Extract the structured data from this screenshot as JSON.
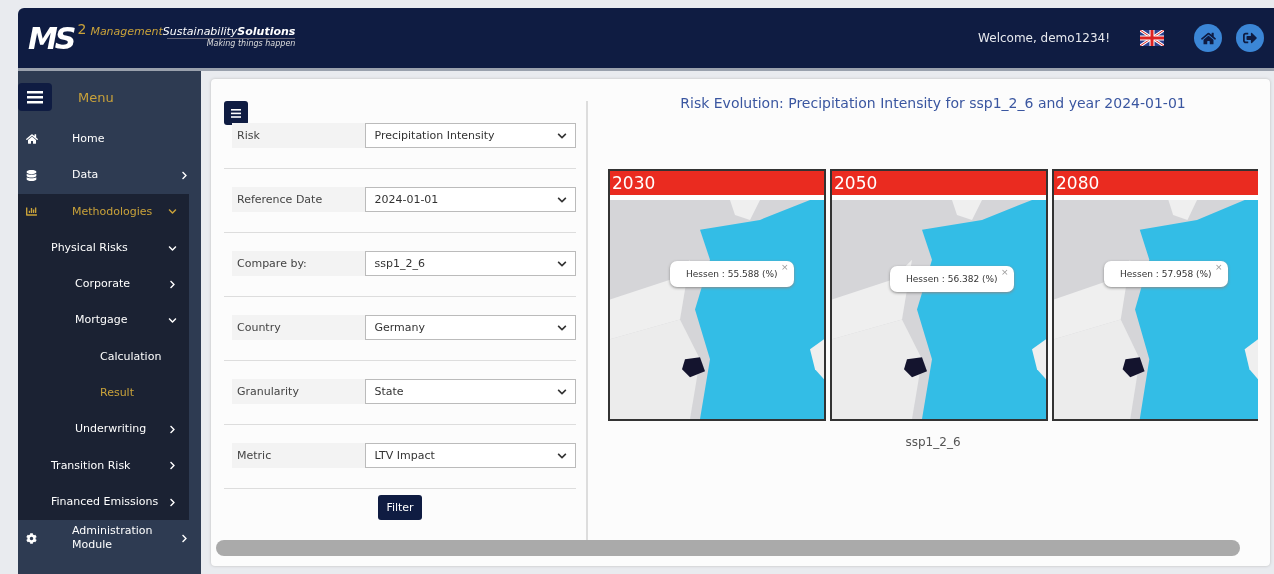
{
  "header": {
    "logo_mark": "MS",
    "logo_sup": "2",
    "logo_word_1": "Management",
    "logo_word_2": "Sustainability",
    "logo_word_3": "Solutions",
    "tagline": "Making things happen",
    "welcome": "Welcome, demo1234!"
  },
  "sidebar": {
    "title": "Menu",
    "items": [
      {
        "label": "Home",
        "kind": "link",
        "selected": false
      },
      {
        "label": "Data",
        "kind": "group",
        "expanded": false,
        "selected": false
      },
      {
        "label": "Methodologies",
        "kind": "group",
        "expanded": true,
        "selected": true,
        "children": [
          {
            "label": "Physical Risks",
            "kind": "group",
            "expanded": true,
            "selected": false,
            "children": [
              {
                "label": "Corporate",
                "kind": "group",
                "expanded": false,
                "selected": false
              },
              {
                "label": "Mortgage",
                "kind": "group",
                "expanded": true,
                "selected": false,
                "children": [
                  {
                    "label": "Calculation",
                    "kind": "link",
                    "selected": false
                  },
                  {
                    "label": "Result",
                    "kind": "link",
                    "selected": true
                  }
                ]
              },
              {
                "label": "Underwriting",
                "kind": "group",
                "expanded": false,
                "selected": false
              }
            ]
          },
          {
            "label": "Transition Risk",
            "kind": "group",
            "expanded": false,
            "selected": false
          },
          {
            "label": "Financed Emissions",
            "kind": "group",
            "expanded": false,
            "selected": false
          }
        ]
      },
      {
        "label": "Administration Module",
        "kind": "group",
        "expanded": false,
        "selected": false
      }
    ]
  },
  "filters": [
    {
      "label": "Risk",
      "value": "Precipitation Intensity"
    },
    {
      "label": "Reference Date",
      "value": "2024-01-01"
    },
    {
      "label": "Compare by:",
      "value": "ssp1_2_6"
    },
    {
      "label": "Country",
      "value": "Germany"
    },
    {
      "label": "Granularity",
      "value": "State"
    },
    {
      "label": "Metric",
      "value": "LTV Impact"
    }
  ],
  "filter_button": "Filter",
  "result": {
    "title": "Risk Evolution: Precipitation Intensity for ssp1_2_6 and year 2024-01-01",
    "maps": [
      {
        "year": "2030",
        "tooltip": "Hessen : 55.588 (%)",
        "close": "×"
      },
      {
        "year": "2050",
        "tooltip": "Hessen : 56.382 (%)",
        "close": "×"
      },
      {
        "year": "2080",
        "tooltip": "Hessen : 57.958 (%)",
        "close": "×"
      }
    ],
    "caption": "ssp1_2_6"
  }
}
